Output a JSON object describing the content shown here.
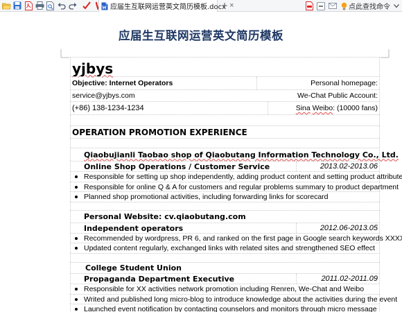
{
  "tab": {
    "title": "应届生互联网运营英文简历模板.docx",
    "close": "×",
    "new": "+"
  },
  "help": {
    "label": "点此查找命令"
  },
  "document": {
    "title": "应届生互联网运营英文简历模板",
    "name": "yjbys",
    "objective": "Objective: Internet Operators",
    "homepage": "Personal homepage:",
    "email": "service@yjbys.com",
    "wechat": "We-Chat Public Account:",
    "phone": "(+86) 138-1234-1234",
    "weibo_label": "Sina",
    "weibo_underlined": "Weibo",
    "weibo_rest": ": (10000 fans)",
    "section": "OPERATION PROMOTION EXPERIENCE",
    "experiences": [
      {
        "company": "Qiaobujianli Taobao shop of Qiaobutang Information Technology Co., Ltd.",
        "role": "Online Shop Operations / Customer Service",
        "dates": "2013.02-2013.06",
        "bullets": [
          "Responsible for setting up shop independently, adding product content and setting product attributes",
          "Responsible for online Q & A for customers and regular problems summary to product department",
          "Planned shop promotional activities, including forwarding links for scorecard"
        ]
      },
      {
        "company": "Personal Website: cv.qiaobutang.com",
        "role": "Independent operators",
        "dates": "2012.06-2013.05",
        "bullets": [
          "Recommended by wordpress, PR 6, and ranked on the first page in Google search keywords XXXX",
          "Updated content regularly, exchanged links with related sites and strengthened SEO effect"
        ]
      },
      {
        "company": "College Student Union",
        "role": "Propaganda Department Executive",
        "dates": "2011.02-2011.09",
        "bullets": [
          "Responsible for XX activities network promotion including Renren, We-Chat and Weibo",
          "Writed and published long micro-blog to introduce knowledge about the activities during the event",
          "Launched event notification by contacting counselors and monitors through micro message"
        ]
      }
    ]
  },
  "colors": {
    "title": "#1f3864",
    "accent_red": "#c0392b",
    "wps_red": "#d9261c"
  },
  "icons": [
    "folder-open-icon",
    "save-icon",
    "pdf-icon",
    "print-icon",
    "print-preview-icon",
    "undo-icon",
    "redo-icon",
    "format-painter-icon",
    "wps-logo-icon",
    "doc-icon",
    "tab-close-icon",
    "new-tab-icon",
    "export-pdf-icon",
    "minimize-icon",
    "mail-icon",
    "lightbulb-icon",
    "chevron-down-icon"
  ]
}
